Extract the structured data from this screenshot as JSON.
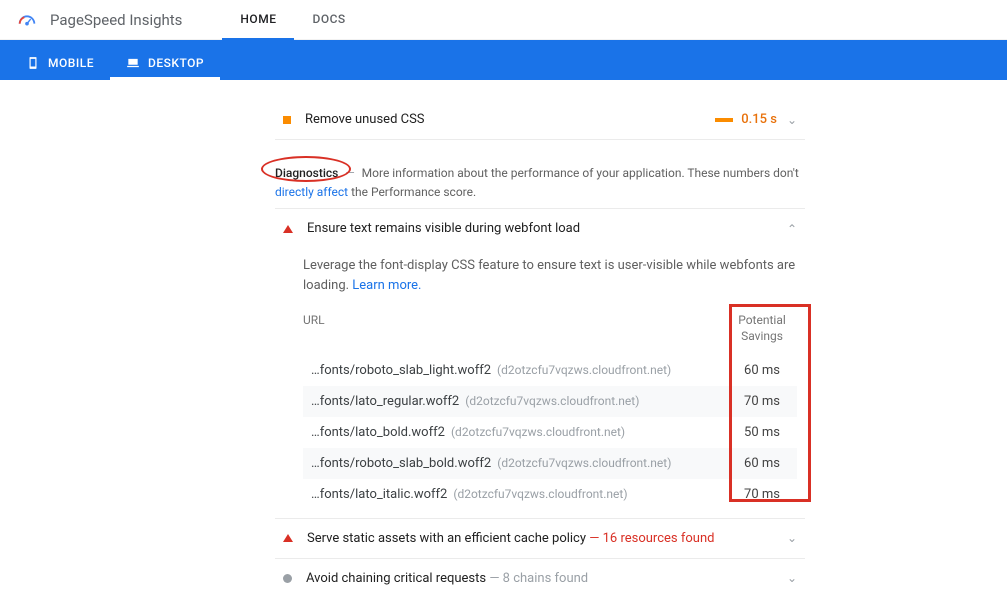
{
  "header": {
    "app_title": "PageSpeed Insights",
    "tabs": {
      "home": "HOME",
      "docs": "DOCS"
    }
  },
  "device_tabs": {
    "mobile": "MOBILE",
    "desktop": "DESKTOP"
  },
  "opportunity": {
    "title": "Remove unused CSS",
    "time": "0.15 s",
    "color_bar": "#fb8c00",
    "color_time": "#e8710a"
  },
  "diagnostics": {
    "label": "Diagnostics",
    "dash": "—",
    "desc_pre": "More information about the performance of your application. These numbers don't ",
    "link": "directly affect",
    "desc_post": " the Performance score."
  },
  "audit_expanded": {
    "title": "Ensure text remains visible during webfont load",
    "desc": "Leverage the font-display CSS feature to ensure text is user-visible while webfonts are loading. ",
    "learn_more": "Learn more.",
    "col_url": "URL",
    "col_sav1": "Potential",
    "col_sav2": "Savings",
    "rows": [
      {
        "path": "…fonts/roboto_slab_light.woff2",
        "host": "(d2otzcfu7vqzws.cloudfront.net)",
        "savings": "60 ms"
      },
      {
        "path": "…fonts/lato_regular.woff2",
        "host": "(d2otzcfu7vqzws.cloudfront.net)",
        "savings": "70 ms"
      },
      {
        "path": "…fonts/lato_bold.woff2",
        "host": "(d2otzcfu7vqzws.cloudfront.net)",
        "savings": "50 ms"
      },
      {
        "path": "…fonts/roboto_slab_bold.woff2",
        "host": "(d2otzcfu7vqzws.cloudfront.net)",
        "savings": "60 ms"
      },
      {
        "path": "…fonts/lato_italic.woff2",
        "host": "(d2otzcfu7vqzws.cloudfront.net)",
        "savings": "70 ms"
      }
    ]
  },
  "audits_collapsed": [
    {
      "icon": "triangle",
      "title": "Serve static assets with an efficient cache policy",
      "sub": "— 16 resources found",
      "sub_red": true
    },
    {
      "icon": "circle",
      "title": "Avoid chaining critical requests",
      "sub": "— 8 chains found",
      "sub_red": false
    }
  ]
}
